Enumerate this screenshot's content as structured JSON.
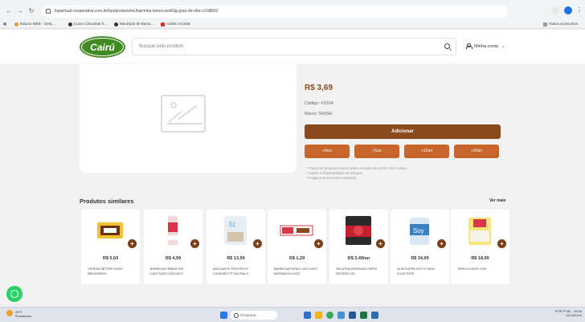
{
  "browser": {
    "url": "lojavirtual.cooperativa.com.br/loja/produto/mc/barrinha-lemon-pet60g-grao-de-ribe-c/198502",
    "bookmarks": [
      "Educar WEB - Gest...",
      "Curso Chocolate h...",
      "Município de Bento...",
      "Adobe Acrobat"
    ],
    "bookmarks_right": "Todos os favoritos"
  },
  "header": {
    "logo_text": "Cairú",
    "search_placeholder": "Busque pelo produto",
    "account_label": "Minha conta"
  },
  "product": {
    "price": "R$ 3,69",
    "code": "Código: #3334",
    "brand": "Marca: TENSEI",
    "add_button": "Adicionar",
    "quantity_buttons": [
      "+5un",
      "+5un",
      "+10un",
      "+20un"
    ],
    "notes": [
      "* Preços de produtos podem sofrer variação de acordo com a peso.",
      "* Sujeito à disponibilidade de estoque.",
      "* Imagens meramente ilustrativas."
    ]
  },
  "similar": {
    "title": "Produtos similares",
    "see_more": "Ver mais",
    "items": [
      {
        "price": "R$ 5,69",
        "name": "CEREAIS BITTER 3X20G BRIGADEIRO"
      },
      {
        "price": "R$ 4,99",
        "name": "BARRA NUTRIBAR 25G CAST.NOR.CHOC.BCO"
      },
      {
        "price": "R$ 13,99",
        "name": "ADOÇANTE STEVITA PO CX/35X8G FIT SUCRALO"
      },
      {
        "price": "R$ 1,29",
        "name": "BARRA NATURALE 25G LIGHT MORANGO/CHOC"
      },
      {
        "price": "R$ 3,49/un",
        "name": "GELATINA MORANGO ZERO OETKER 12G"
      },
      {
        "price": "R$ 34,99",
        "name": "ALIM.SUPRA SOY LT/300G S/LACTOSE"
      },
      {
        "price": "R$ 18,99",
        "name": "TAPIOCA 500G YOKI"
      }
    ]
  },
  "taskbar": {
    "weather_temp": "25°C",
    "weather_desc": "Ensolarado",
    "search": "Pesquisar",
    "time": "09:06",
    "date": "14/10/2024",
    "lang": "POR PTB2"
  }
}
